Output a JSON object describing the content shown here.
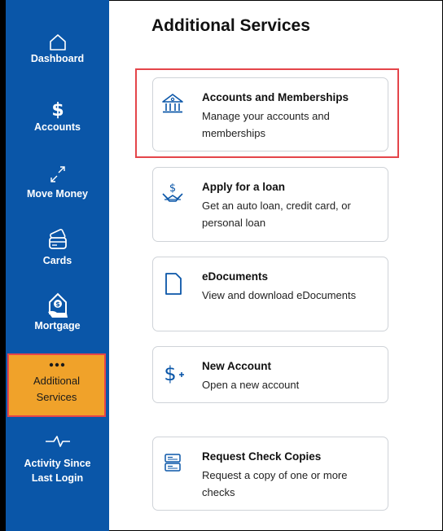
{
  "page_title": "Additional Services",
  "sidebar": {
    "items": [
      {
        "label": "Dashboard",
        "icon": "home-icon"
      },
      {
        "label": "Accounts",
        "icon": "dollar-icon"
      },
      {
        "label": "Move Money",
        "icon": "transfer-arrows-icon"
      },
      {
        "label": "Cards",
        "icon": "card-icon"
      },
      {
        "label": "Mortgage",
        "icon": "mortgage-house-icon"
      },
      {
        "label": "Additional Services",
        "icon": "more-dots-icon",
        "active": true
      },
      {
        "label": "Activity Since Last Login",
        "icon": "pulse-icon"
      }
    ]
  },
  "services": [
    {
      "title": "Accounts and Memberships",
      "description": "Manage your accounts and memberships",
      "icon": "bank-icon",
      "highlighted": true
    },
    {
      "title": "Apply for a loan",
      "description": "Get an auto loan, credit card, or personal loan",
      "icon": "loan-icon"
    },
    {
      "title": "eDocuments",
      "description": "View and download eDocuments",
      "icon": "document-icon"
    },
    {
      "title": "New Account",
      "description": "Open a new account",
      "icon": "dollar-plus-icon"
    },
    {
      "title": "Request Check Copies",
      "description": "Request a copy of one or more checks",
      "icon": "checks-icon"
    }
  ],
  "colors": {
    "sidebar": "#0a56a8",
    "active_item": "#f0a22a",
    "highlight_border": "#e4454a",
    "icon_blue": "#0a56a8"
  }
}
